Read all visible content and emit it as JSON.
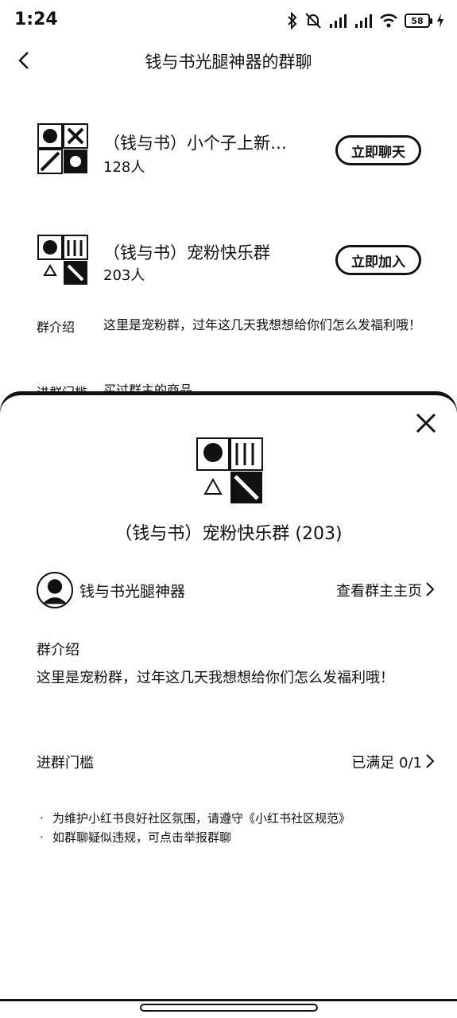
{
  "status_bar": {
    "time": "1:24",
    "battery": "58"
  },
  "header": {
    "title": "钱与书光腿神器的群聊"
  },
  "groups": [
    {
      "name": "（钱与书）小个子上新…",
      "count": "128人",
      "button": "立即聊天"
    },
    {
      "name": "（钱与书）宠粉快乐群",
      "count": "203人",
      "button": "立即加入"
    }
  ],
  "group_info": {
    "intro_label": "群介绍",
    "intro_text": "这里是宠粉群，过年这几天我想想给你们怎么发福利哦！",
    "threshold_label": "进群门槛",
    "threshold_text": "买过群主的商品"
  },
  "sheet": {
    "title": "（钱与书）宠粉快乐群 (203)",
    "owner_name": "钱与书光腿神器",
    "owner_link": "查看群主主页",
    "intro_label": "群介绍",
    "intro_text": "这里是宠粉群，过年这几天我想想给你们怎么发福利哦！",
    "threshold_label": "进群门槛",
    "threshold_value": "已满足 0/1",
    "notes": [
      "为维护小红书良好社区氛围，请遵守《小红书社区规范》",
      "如群聊疑似违规，可点击举报群聊"
    ]
  }
}
